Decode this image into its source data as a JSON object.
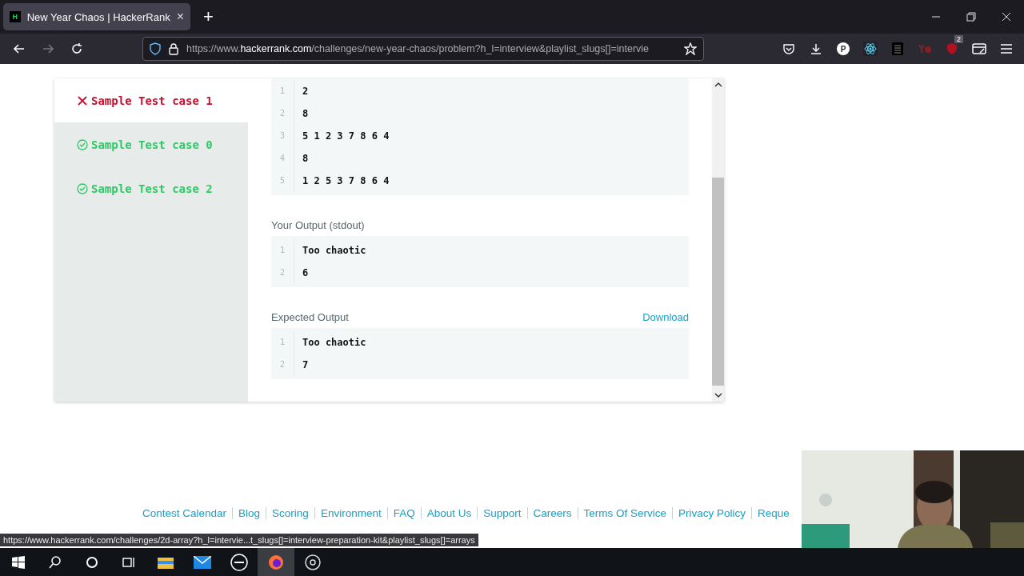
{
  "browser": {
    "tab": {
      "title": "New Year Chaos | HackerRank",
      "close": "×",
      "favicon": "H"
    },
    "new_tab": "+",
    "url": {
      "prefix": "https://www.",
      "domain": "hackerrank.com",
      "path": "/challenges/new-year-chaos/problem?h_l=interview&playlist_slugs[]=intervie"
    },
    "profile_letter": "P",
    "ublock_count": "2"
  },
  "tests": [
    {
      "label": "Sample Test case 1",
      "failed": true,
      "selected": true
    },
    {
      "label": "Sample Test case 0",
      "failed": false,
      "selected": false
    },
    {
      "label": "Sample Test case 2",
      "failed": false,
      "selected": false
    }
  ],
  "sections": [
    {
      "lines": [
        {
          "num": "1",
          "text": "2"
        },
        {
          "num": "2",
          "text": "8"
        },
        {
          "num": "3",
          "text": "5 1 2 3 7 8 6 4"
        },
        {
          "num": "4",
          "text": "8"
        },
        {
          "num": "5",
          "text": "1 2 5 3 7 8 6 4"
        }
      ]
    },
    {
      "title": "Your Output (stdout)",
      "lines": [
        {
          "num": "1",
          "text": "Too chaotic"
        },
        {
          "num": "2",
          "text": "6"
        }
      ]
    },
    {
      "title": "Expected Output",
      "action": "Download",
      "lines": [
        {
          "num": "1",
          "text": "Too chaotic"
        },
        {
          "num": "2",
          "text": "7"
        }
      ]
    }
  ],
  "footer_links": [
    "Contest Calendar",
    "Blog",
    "Scoring",
    "Environment",
    "FAQ",
    "About Us",
    "Support",
    "Careers",
    "Terms Of Service",
    "Privacy Policy",
    "Reque"
  ],
  "status_url": "https://www.hackerrank.com/challenges/2d-array?h_l=intervie...t_slugs[]=interview-preparation-kit&playlist_slugs[]=arrays"
}
